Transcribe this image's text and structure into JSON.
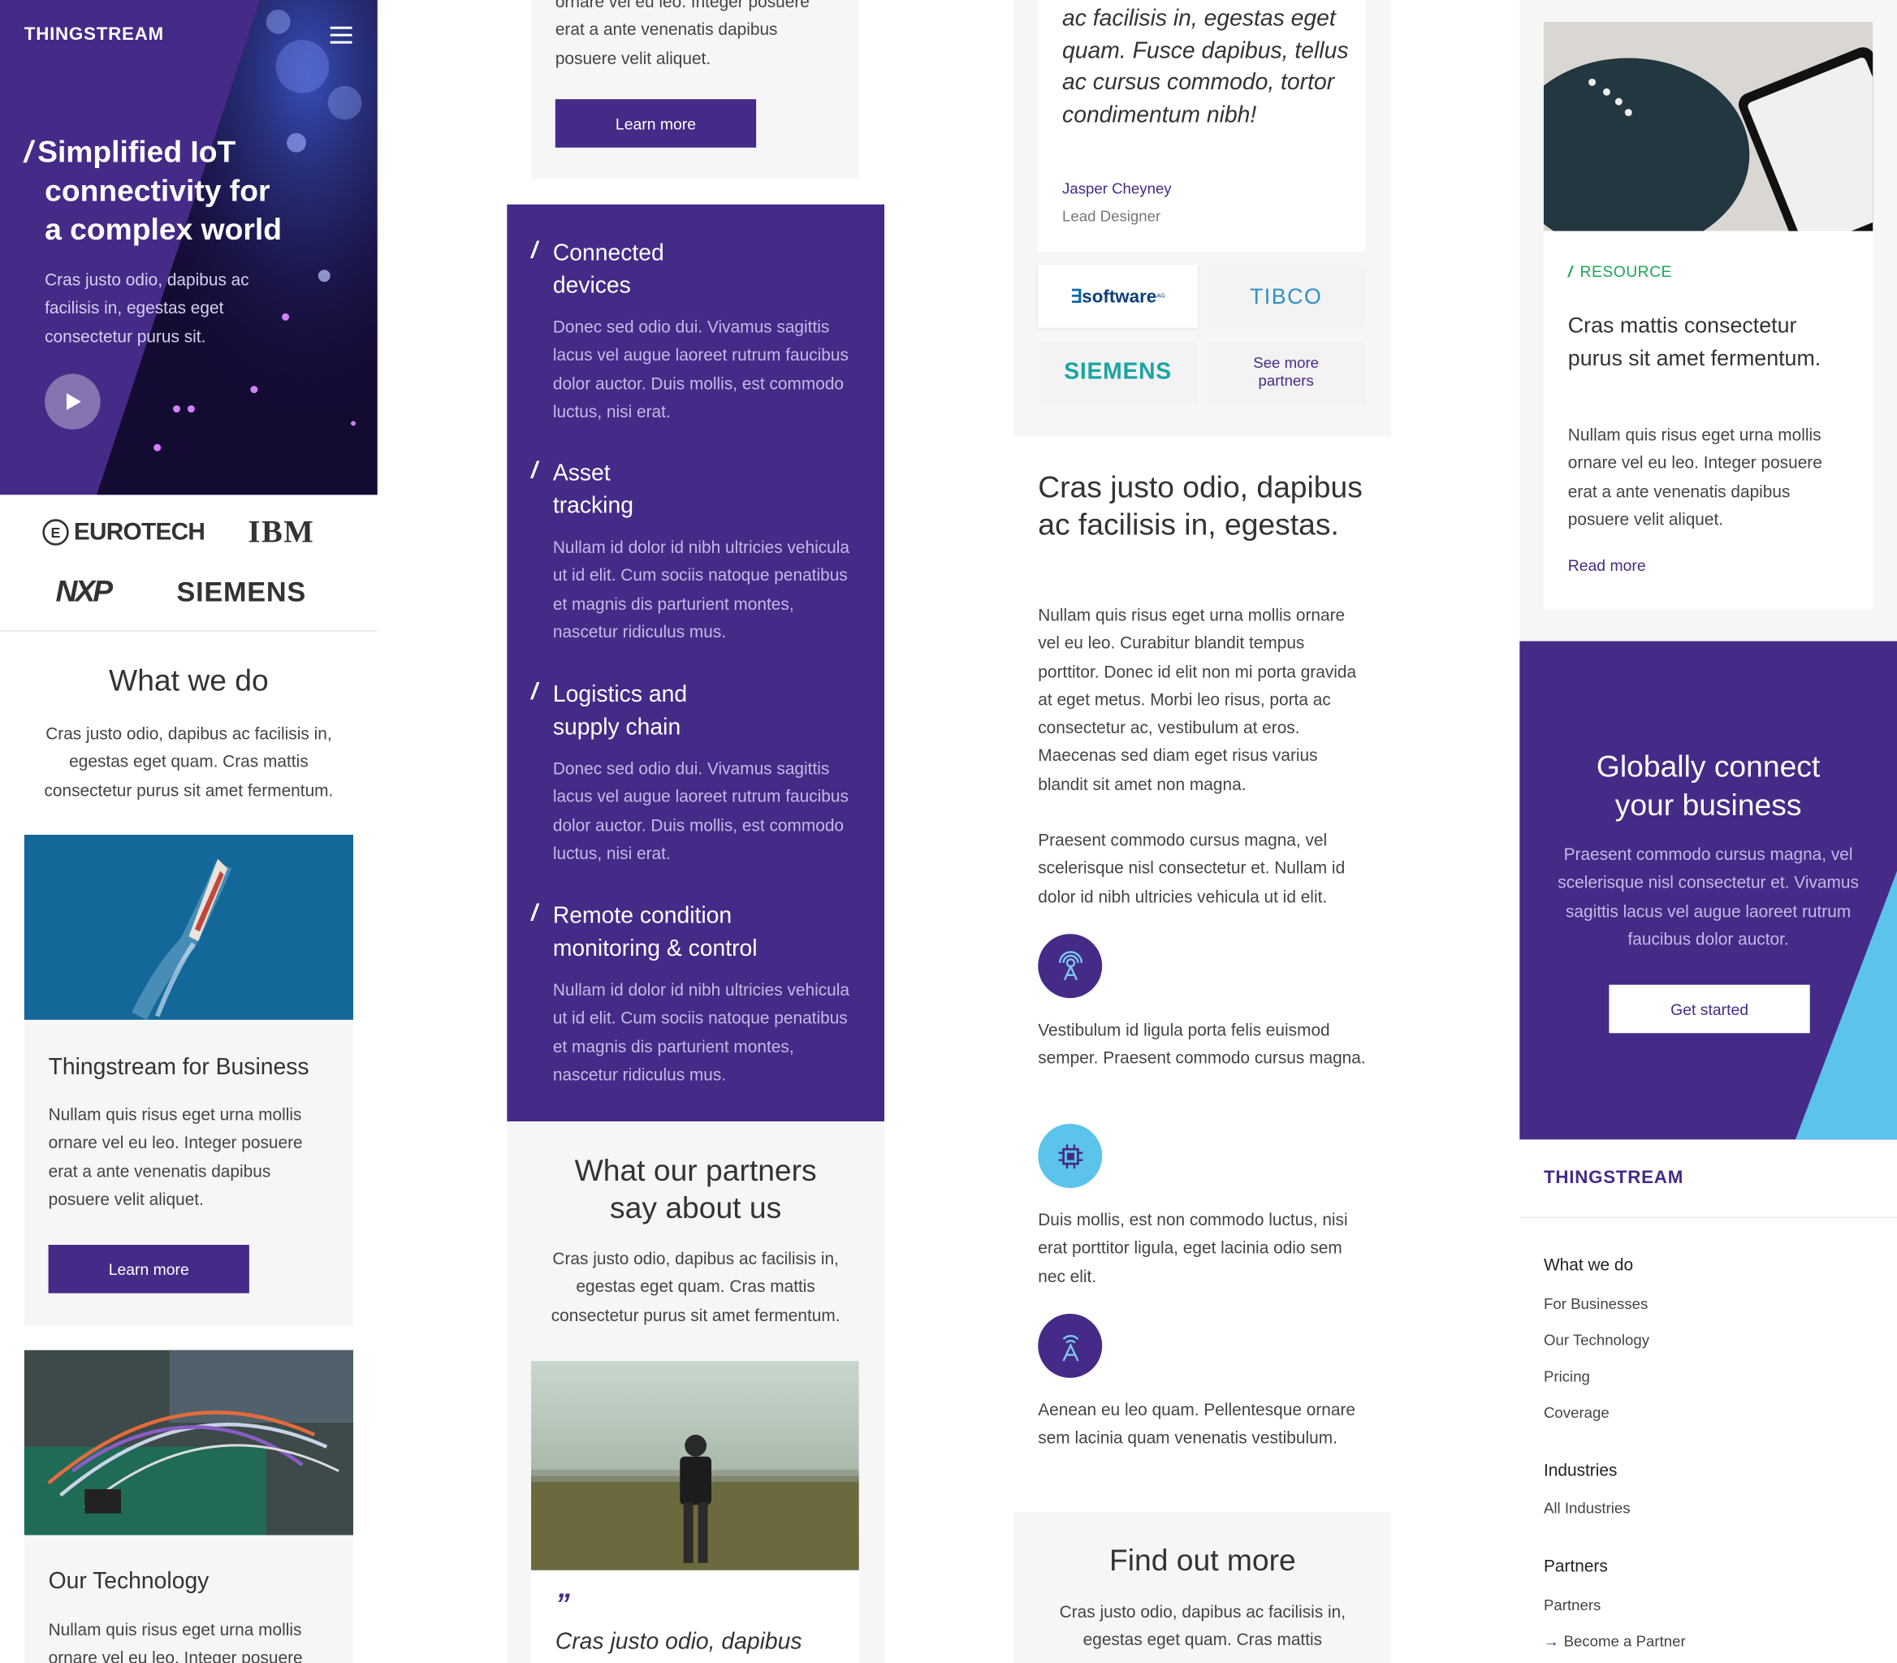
{
  "colors": {
    "brand": "#452a87",
    "accent": "#5bc3ec",
    "green": "#1ea65a"
  },
  "hero": {
    "logo": "THINGSTREAM",
    "title_l1": "Simplified IoT",
    "title_l2": "connectivity for",
    "title_l3": "a complex world",
    "slash": "/",
    "body": "Cras justo odio, dapibus ac facilisis in, egestas eget consectetur purus sit.",
    "menu_icon": "hamburger-menu-icon",
    "play_icon": "play-icon"
  },
  "clients": [
    "EUROTECH",
    "IBM",
    "NXP",
    "SIEMENS"
  ],
  "what_we_do": {
    "title": "What we do",
    "body": "Cras justo odio, dapibus ac facilisis in, egestas eget quam. Cras mattis consectetur purus sit amet fermentum."
  },
  "card_business": {
    "title": "Thingstream for Business",
    "body": "Nullam quis risus eget urna mollis ornare vel eu leo. Integer posuere erat a ante venenatis dapibus posuere velit aliquet.",
    "button": "Learn more"
  },
  "card_tech": {
    "title": "Our Technology",
    "body_partial": "Nullam quis risus eget urna mollis ornare vel eu leo. Integer posuere"
  },
  "col2_top": {
    "body_partial": "ornare vel eu leo. Integer posuere erat a ante venenatis dapibus posuere velit aliquet.",
    "button": "Learn more"
  },
  "features": [
    {
      "title_l1": "Connected",
      "title_l2": "devices",
      "body": "Donec sed odio dui. Vivamus sagittis lacus vel augue laoreet rutrum faucibus dolor auctor. Duis mollis, est commodo luctus, nisi erat."
    },
    {
      "title_l1": "Asset",
      "title_l2": "tracking",
      "body": "Nullam id dolor id nibh ultricies vehicula ut id elit. Cum sociis natoque penatibus et magnis dis parturient montes, nascetur ridiculus mus."
    },
    {
      "title_l1": "Logistics and",
      "title_l2": "supply chain",
      "body": "Donec sed odio dui. Vivamus sagittis lacus vel augue laoreet rutrum faucibus dolor auctor. Duis mollis, est commodo luctus, nisi erat."
    },
    {
      "title_l1": "Remote condition",
      "title_l2": "monitoring & control",
      "body": "Nullam id dolor id nibh ultricies vehicula ut id elit. Cum sociis natoque penatibus et magnis dis parturient montes, nascetur ridiculus mus."
    }
  ],
  "partners": {
    "title_l1": "What our partners",
    "title_l2": "say about us",
    "body": "Cras justo odio, dapibus ac facilisis in, egestas eget quam. Cras mattis consectetur purus sit amet fermentum.",
    "quote_mark": "”",
    "quote_start": "Cras justo odio, dapibus"
  },
  "testimonial": {
    "quote": "ac facilisis in, egestas eget quam. Fusce dapibus, tellus ac cursus commodo, tortor condimentum nibh!",
    "name": "Jasper Cheyney",
    "role": "Lead Designer"
  },
  "partner_logos": {
    "software": "software",
    "software_sup": "AG",
    "tibco": "TIBCO",
    "siemens": "SIEMENS",
    "see_more_l1": "See more",
    "see_more_l2": "partners"
  },
  "info": {
    "title": "Cras justo odio, dapibus ac facilisis in, egestas.",
    "p1": "Nullam quis risus eget urna mollis ornare vel eu leo. Curabitur blandit tempus porttitor. Donec id elit non mi porta gravida at eget metus. Morbi leo risus, porta ac consectetur ac, vestibulum at eros. Maecenas sed diam eget risus varius blandit sit amet non magna.",
    "p2": "Praesent commodo cursus magna, vel scelerisque nisl consectetur et. Nullam id dolor id nibh ultricies vehicula ut id elit.",
    "i1": "Vestibulum id ligula porta felis euismod semper. Praesent commodo cursus magna.",
    "i2": "Duis mollis, est non commodo luctus, nisi erat porttitor ligula, eget lacinia odio sem nec elit.",
    "i3": "Aenean eu leo quam. Pellentesque ornare sem lacinia quam venenatis vestibulum."
  },
  "find_out": {
    "title": "Find out more",
    "body_partial": "Cras justo odio, dapibus ac facilisis in, egestas eget quam. Cras mattis"
  },
  "resource": {
    "tag": "RESOURCE",
    "title": "Cras mattis consectetur purus sit amet fermentum.",
    "body": "Nullam quis risus eget urna mollis ornare vel eu leo. Integer posuere erat a ante venenatis dapibus posuere velit aliquet.",
    "link": "Read more"
  },
  "cta": {
    "title_l1": "Globally connect",
    "title_l2": "your business",
    "body": "Praesent commodo cursus magna, vel scelerisque nisl consectetur et. Vivamus sagittis lacus vel augue laoreet rutrum faucibus dolor auctor.",
    "button": "Get started"
  },
  "footer": {
    "logo": "THINGSTREAM",
    "h1": "What we do",
    "links1": [
      "For Businesses",
      "Our Technology",
      "Pricing",
      "Coverage"
    ],
    "h2": "Industries",
    "links2": [
      "All Industries"
    ],
    "h3": "Partners",
    "links3": [
      "Partners",
      "Become a Partner"
    ],
    "arrow": "→"
  }
}
